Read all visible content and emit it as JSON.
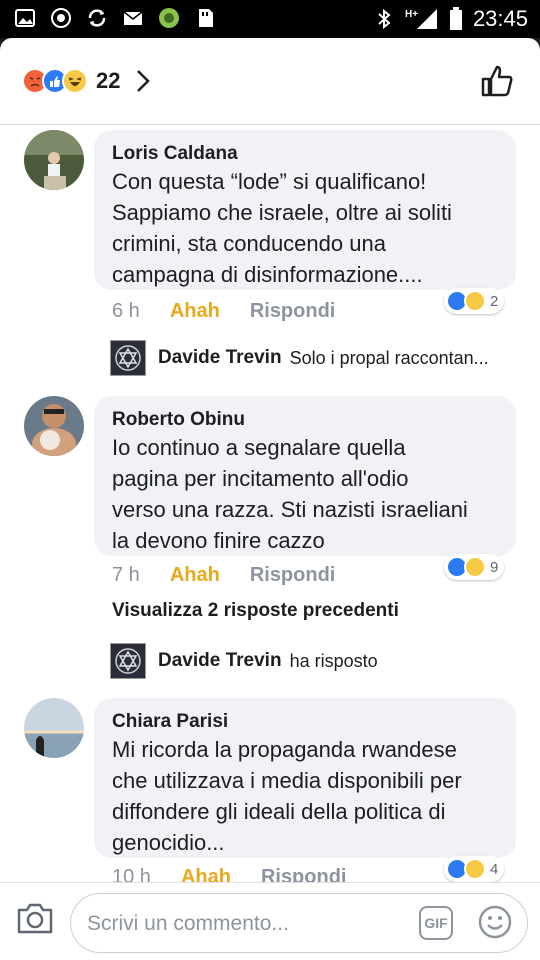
{
  "status_bar": {
    "time": "23:45",
    "network": "H+"
  },
  "header": {
    "reaction_count": "22"
  },
  "comments": [
    {
      "author": "Loris Caldana",
      "text_lines": [
        "Con questa “lode” si qualificano!",
        "Sappiamo che israele, oltre ai soliti",
        "crimini, sta conducendo una",
        "campagna di disinformazione...."
      ],
      "time": "6 h",
      "ahah": "Ahah",
      "reply": "Rispondi",
      "reactions": "2"
    },
    {
      "author": "Roberto Obinu",
      "text_lines": [
        "Io continuo a segnalare quella",
        "pagina per incitamento all'odio",
        "verso una razza. Sti nazisti israeliani",
        "la devono finire cazzo"
      ],
      "time": "7 h",
      "ahah": "Ahah",
      "reply": "Rispondi",
      "reactions": "9"
    },
    {
      "author": "Chiara Parisi",
      "text_lines": [
        "Mi ricorda la propaganda rwandese",
        "che utilizzava i media disponibili per",
        "diffondere gli ideali della politica di",
        "genocidio..."
      ],
      "time": "10 h",
      "ahah": "Ahah",
      "reply": "Rispondi",
      "reactions": "4"
    }
  ],
  "replies": [
    {
      "author": "Davide Trevin",
      "text": "Solo i propal raccontan..."
    },
    {
      "author": "Davide Trevin",
      "text": "ha risposto"
    }
  ],
  "view_previous": "Visualizza 2 risposte precedenti",
  "composer": {
    "placeholder": "Scrivi un commento...",
    "gif_label": "GIF"
  },
  "colors": {
    "ahah": "#e7a91e",
    "like": "#2d7bf4",
    "haha": "#f7c945",
    "angry": "#f4603a",
    "bubble": "#f0f2f5"
  }
}
